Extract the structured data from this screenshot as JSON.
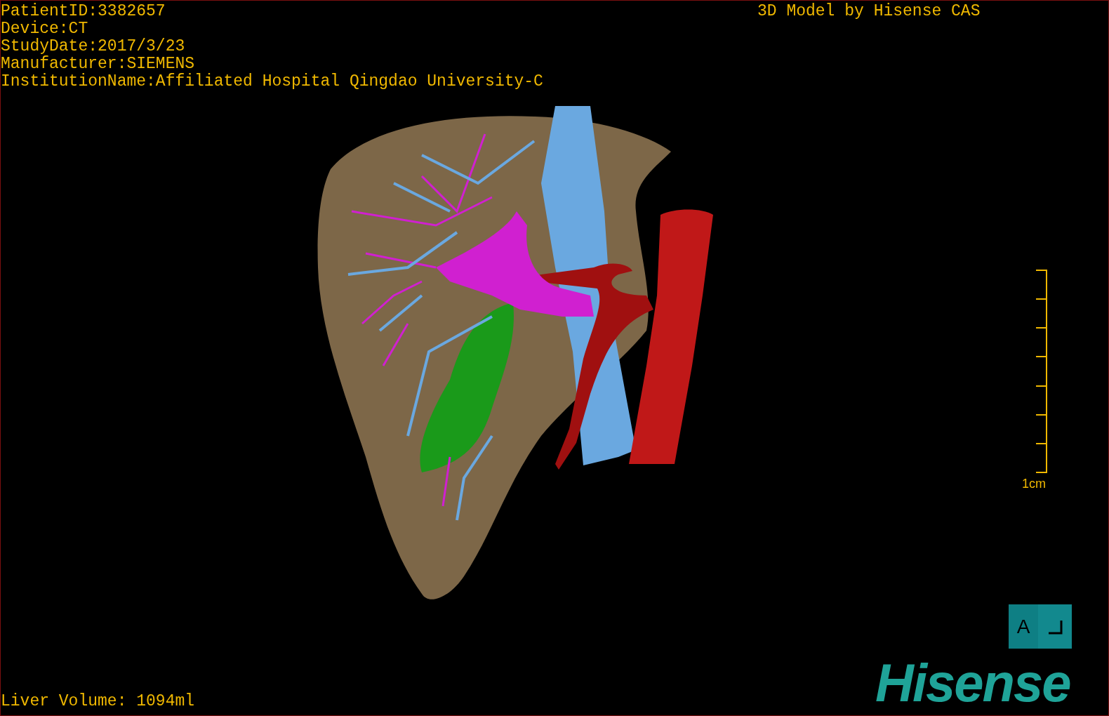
{
  "patient_info": [
    "PatientID:3382657",
    "Device:CT",
    "StudyDate:2017/3/23",
    "Manufacturer:SIEMENS",
    "InstitutionName:Affiliated Hospital Qingdao University-C"
  ],
  "title": "3D Model by Hisense CAS",
  "scale_bar": {
    "label": "1cm"
  },
  "orientation_cube": {
    "label": "A"
  },
  "logo": "Hisense",
  "liver_volume": "Liver Volume: 1094ml"
}
